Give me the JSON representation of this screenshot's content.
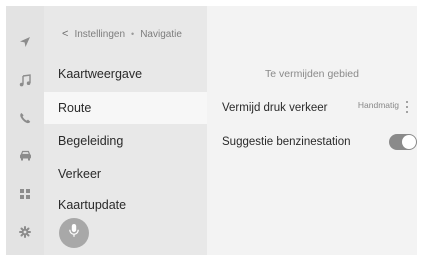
{
  "breadcrumb": {
    "back_symbol": "<",
    "parent": "Instellingen",
    "separator": "•",
    "current": "Navigatie"
  },
  "icons": [
    "navigation-arrow-icon",
    "music-note-icon",
    "phone-icon",
    "car-icon",
    "apps-grid-icon",
    "settings-gear-icon",
    "microphone-icon"
  ],
  "menu": {
    "items": [
      {
        "label": "Kaartweergave",
        "active": false
      },
      {
        "label": "Route",
        "active": true
      },
      {
        "label": "Begeleiding",
        "active": false
      },
      {
        "label": "Verkeer",
        "active": false
      },
      {
        "label": "Kaartupdate",
        "active": false
      }
    ]
  },
  "content": {
    "section_title": "Te vermijden gebied",
    "rows": [
      {
        "label": "Vermijd druk verkeer",
        "value": "Handmatig"
      },
      {
        "label": "Suggestie benzinestation",
        "toggle_on": true
      }
    ]
  },
  "colors": {
    "frame": "#ececec",
    "icon_bar": "#e3e3e3",
    "menu_bg": "#e8e8e8",
    "menu_active": "#f7f7f7",
    "content_bg": "#f3f3f3",
    "icon": "#8c8c8c",
    "toggle_on": "#8a8a8a"
  }
}
